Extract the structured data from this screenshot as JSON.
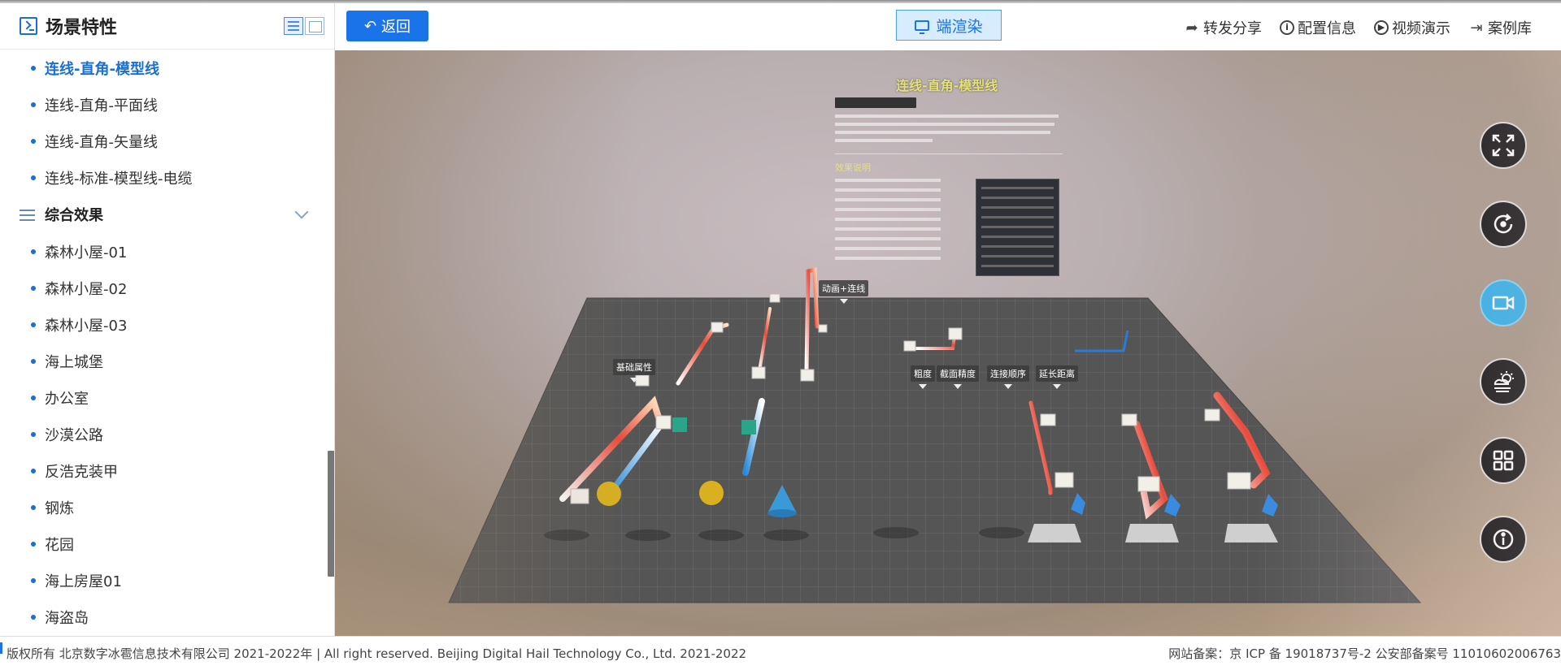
{
  "sidebar": {
    "title": "场景特性",
    "items_top": [
      "连线-直角-模型线",
      "连线-直角-平面线",
      "连线-直角-矢量线",
      "连线-标准-模型线-电缆"
    ],
    "active_index": 0,
    "group": {
      "label": "综合效果",
      "items": [
        "森林小屋-01",
        "森林小屋-02",
        "森林小屋-03",
        "海上城堡",
        "办公室",
        "沙漠公路",
        "反浩克装甲",
        "钢炼",
        "花园",
        "海上房屋01",
        "海盗岛"
      ]
    }
  },
  "toolbar": {
    "back_label": "返回",
    "render_label": "端渲染",
    "links": [
      "转发分享",
      "配置信息",
      "视频演示",
      "案例库"
    ]
  },
  "viewport": {
    "title": "连线-直角-模型线",
    "doc_subtitle": "效果说明",
    "labels": [
      "动画+连线",
      "基础属性",
      "粗度",
      "截面精度",
      "连接顺序",
      "延长距离"
    ]
  },
  "fabs": [
    "fullscreen-icon",
    "refresh-icon",
    "video-icon",
    "weather-icon",
    "grid-icon",
    "info-icon"
  ],
  "footer": {
    "left": "版权所有 北京数字冰雹信息技术有限公司 2021-2022年 | All right reserved. Beijing Digital Hail Technology Co., Ltd. 2021-2022",
    "right": "网站备案：京 ICP 备 19018737号-2 公安部备案号 11010602006763"
  },
  "colors": {
    "accent": "#1a73e8",
    "active_fab": "#1ea9e8"
  }
}
